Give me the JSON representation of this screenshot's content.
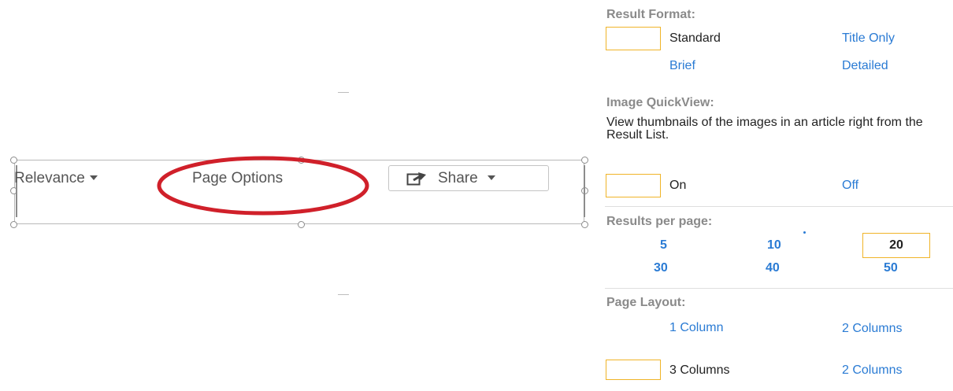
{
  "toolbar": {
    "sort_label": "Relevance",
    "page_options_label": "Page Options",
    "share_label": "Share"
  },
  "result_format": {
    "heading": "Result Format:",
    "options": {
      "standard": "Standard",
      "title_only": "Title Only",
      "brief": "Brief",
      "detailed": "Detailed"
    },
    "selected": "Standard"
  },
  "image_quickview": {
    "heading": "Image QuickView:",
    "description": "View thumbnails of the images in an article right from the Result List.",
    "on_label": "On",
    "off_label": "Off",
    "selected": "On"
  },
  "results_per_page": {
    "heading": "Results per page:",
    "options": [
      "5",
      "10",
      "20",
      "30",
      "40",
      "50"
    ],
    "selected": "20"
  },
  "page_layout": {
    "heading": "Page Layout:",
    "options": {
      "one_column": "1 Column",
      "two_columns_top": "2 Columns",
      "three_columns": "3 Columns",
      "two_columns_bottom": "2 Columns"
    },
    "selected": "3 Columns"
  },
  "colors": {
    "link": "#2a7bd4",
    "heading": "#8a8a8a",
    "selection_border": "#f0b428",
    "annotation_circle": "#d0202a"
  },
  "icons": {
    "share": "share-arrow-icon",
    "dropdown": "chevron-down-icon"
  }
}
